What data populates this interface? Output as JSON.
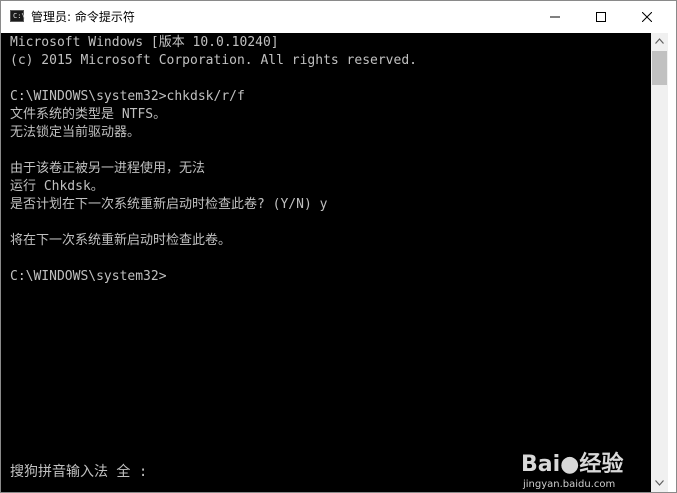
{
  "window": {
    "title": "管理员: 命令提示符",
    "icon": "cmd-icon",
    "icon_glyph": "C:\\",
    "controls": {
      "minimize": "minimize-icon",
      "maximize": "maximize-icon",
      "close": "close-icon"
    }
  },
  "console": {
    "lines": [
      "Microsoft Windows [版本 10.0.10240]",
      "(c) 2015 Microsoft Corporation. All rights reserved.",
      "",
      "C:\\WINDOWS\\system32>chkdsk/r/f",
      "文件系统的类型是 NTFS。",
      "无法锁定当前驱动器。",
      "",
      "由于该卷正被另一进程使用，无法",
      "运行 Chkdsk。",
      "是否计划在下一次系统重新启动时检查此卷? (Y/N) y",
      "",
      "将在下一次系统重新启动时检查此卷。",
      "",
      "C:\\WINDOWS\\system32>"
    ],
    "ime_status": "搜狗拼音输入法 全 :",
    "background": "#000000",
    "foreground": "#c0c0c0"
  },
  "watermark": {
    "logo_text": "Bai●经验",
    "url": "jingyan.baidu.com"
  }
}
